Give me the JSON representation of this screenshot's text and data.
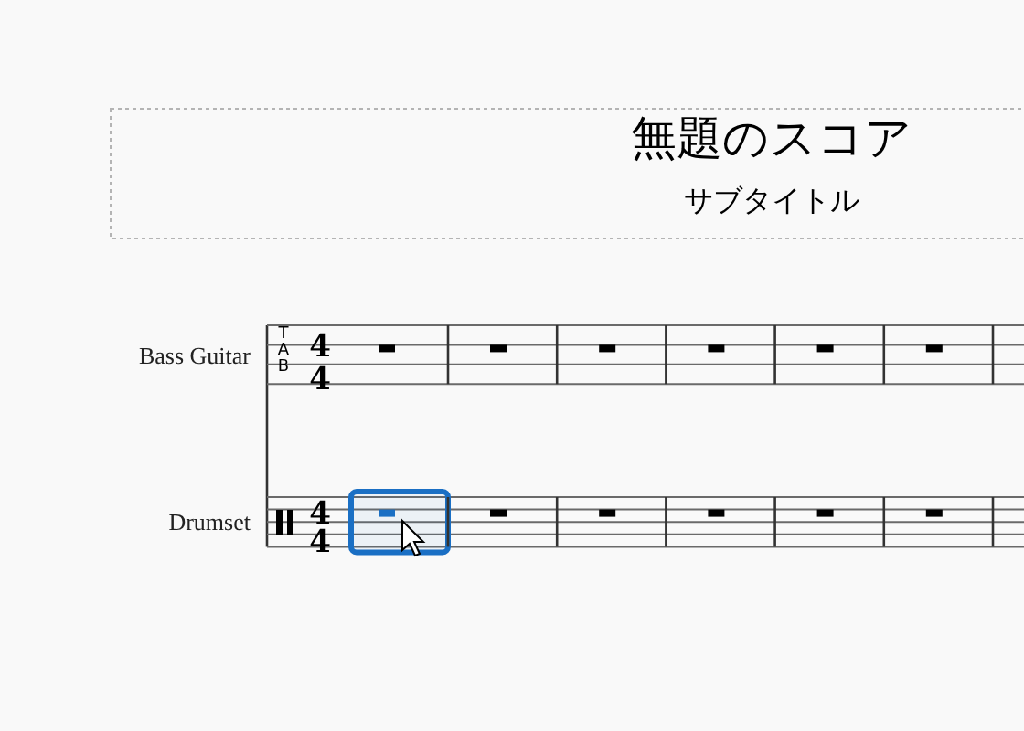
{
  "title": "無題のスコア",
  "subtitle": "サブタイトル",
  "staves": [
    {
      "name": "Bass Guitar",
      "kind": "tab",
      "clef": [
        "T",
        "A",
        "B"
      ],
      "time": [
        "4",
        "4"
      ],
      "measures": [
        {
          "selected": false
        },
        {
          "selected": false
        },
        {
          "selected": false
        },
        {
          "selected": false
        },
        {
          "selected": false
        },
        {
          "selected": false
        }
      ]
    },
    {
      "name": "Drumset",
      "kind": "percussion",
      "time": [
        "4",
        "4"
      ],
      "measures": [
        {
          "selected": true
        },
        {
          "selected": false
        },
        {
          "selected": false
        },
        {
          "selected": false
        },
        {
          "selected": false
        },
        {
          "selected": false
        }
      ]
    }
  ]
}
